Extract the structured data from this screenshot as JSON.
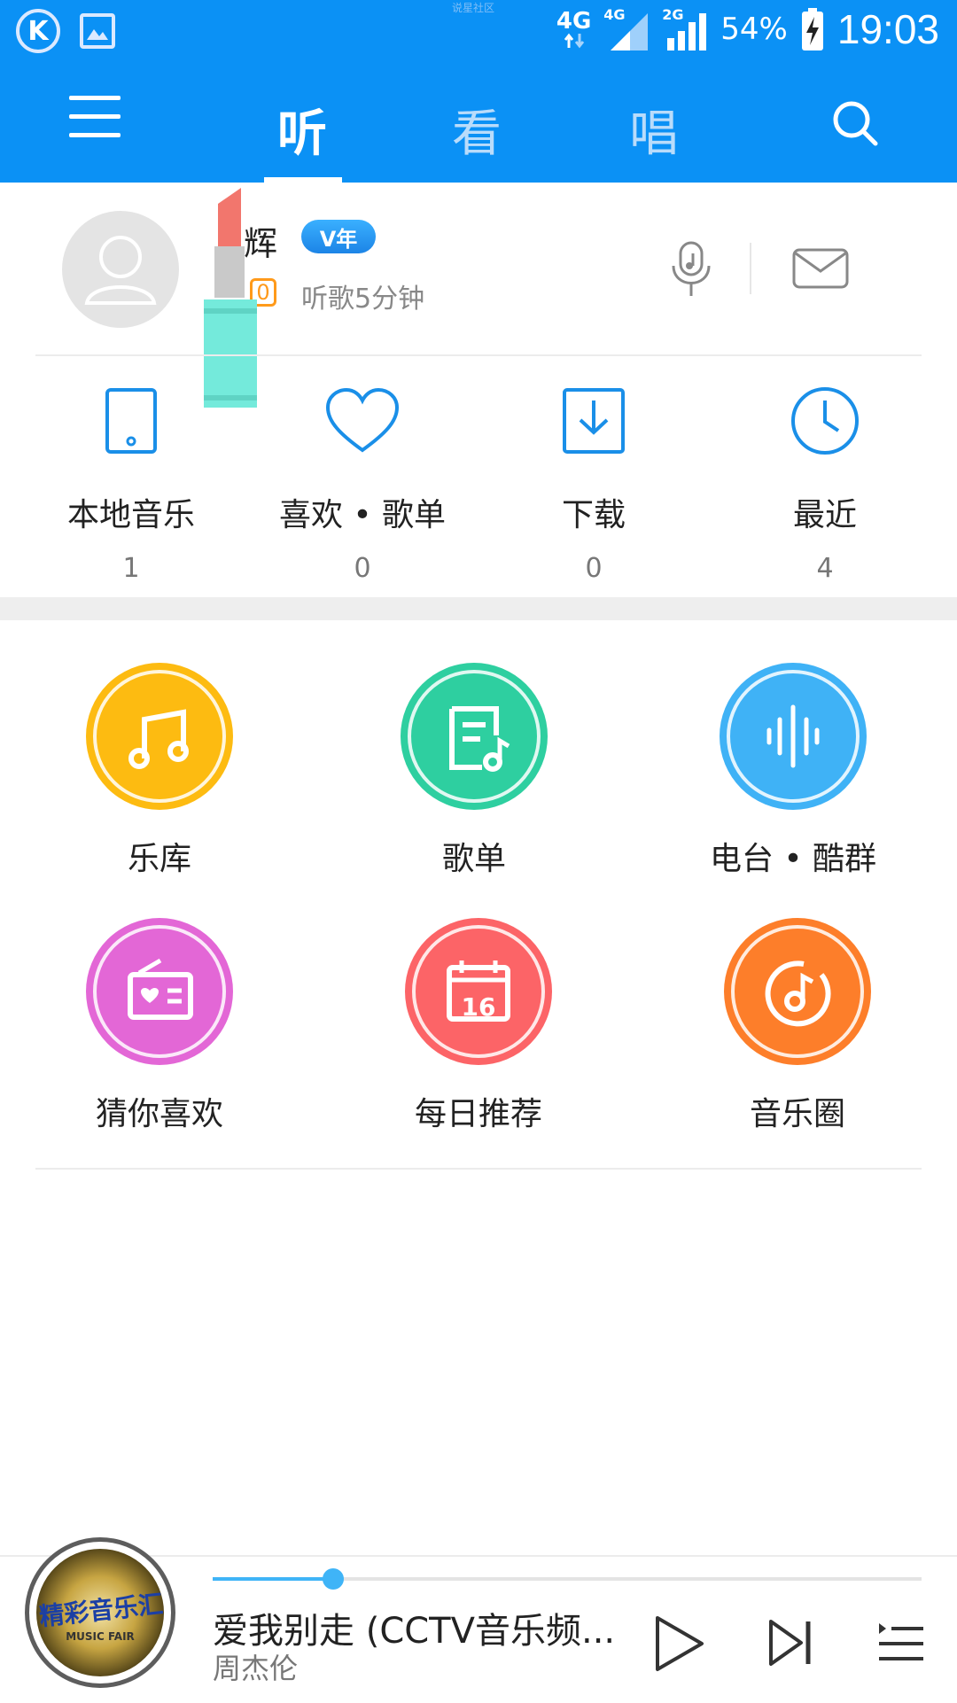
{
  "status_bar": {
    "watermark": "说星社区",
    "network_main": "4G",
    "network_sim1": "4G",
    "network_sim2": "2G",
    "battery": "54%",
    "time": "19:03",
    "app_icon": "k-app-icon",
    "gallery_icon": "image-icon"
  },
  "topnav": {
    "tabs": [
      "听",
      "看",
      "唱"
    ],
    "active_tab": "听",
    "menu_icon": "menu-icon",
    "search_icon": "search-icon",
    "accent": "#0b91f5"
  },
  "profile": {
    "name": "辉",
    "vip_badge": "V年",
    "level": "0",
    "listen_time": "听歌5分钟",
    "mic_icon": "mic-music-icon",
    "mail_icon": "mail-icon"
  },
  "quick_access": [
    {
      "label": "本地音乐",
      "count": "1",
      "icon": "tablet-icon"
    },
    {
      "label": "喜欢 • 歌单",
      "count": "0",
      "icon": "heart-icon"
    },
    {
      "label": "下载",
      "count": "0",
      "icon": "download-icon"
    },
    {
      "label": "最近",
      "count": "4",
      "icon": "clock-icon"
    }
  ],
  "features": [
    {
      "label": "乐库",
      "icon": "music-note-icon",
      "color": "#fdbb11"
    },
    {
      "label": "歌单",
      "icon": "playlist-icon",
      "color": "#2ecfa0"
    },
    {
      "label": "电台 • 酷群",
      "icon": "soundwave-icon",
      "color": "#3fb2f6"
    },
    {
      "label": "猜你喜欢",
      "icon": "radio-heart-icon",
      "color": "#e367d6"
    },
    {
      "label": "每日推荐",
      "icon": "calendar-icon",
      "color": "#fc6467",
      "day": "16"
    },
    {
      "label": "音乐圈",
      "icon": "music-circle-icon",
      "color": "#fd7e2a"
    }
  ],
  "player": {
    "title": "爱我别走 (CCTV音乐频...",
    "artist": "周杰伦",
    "progress": 0.17,
    "album_art_text": "精彩音乐汇",
    "album_art_subtext": "MUSIC FAIR",
    "accent": "#3fb4f7"
  }
}
